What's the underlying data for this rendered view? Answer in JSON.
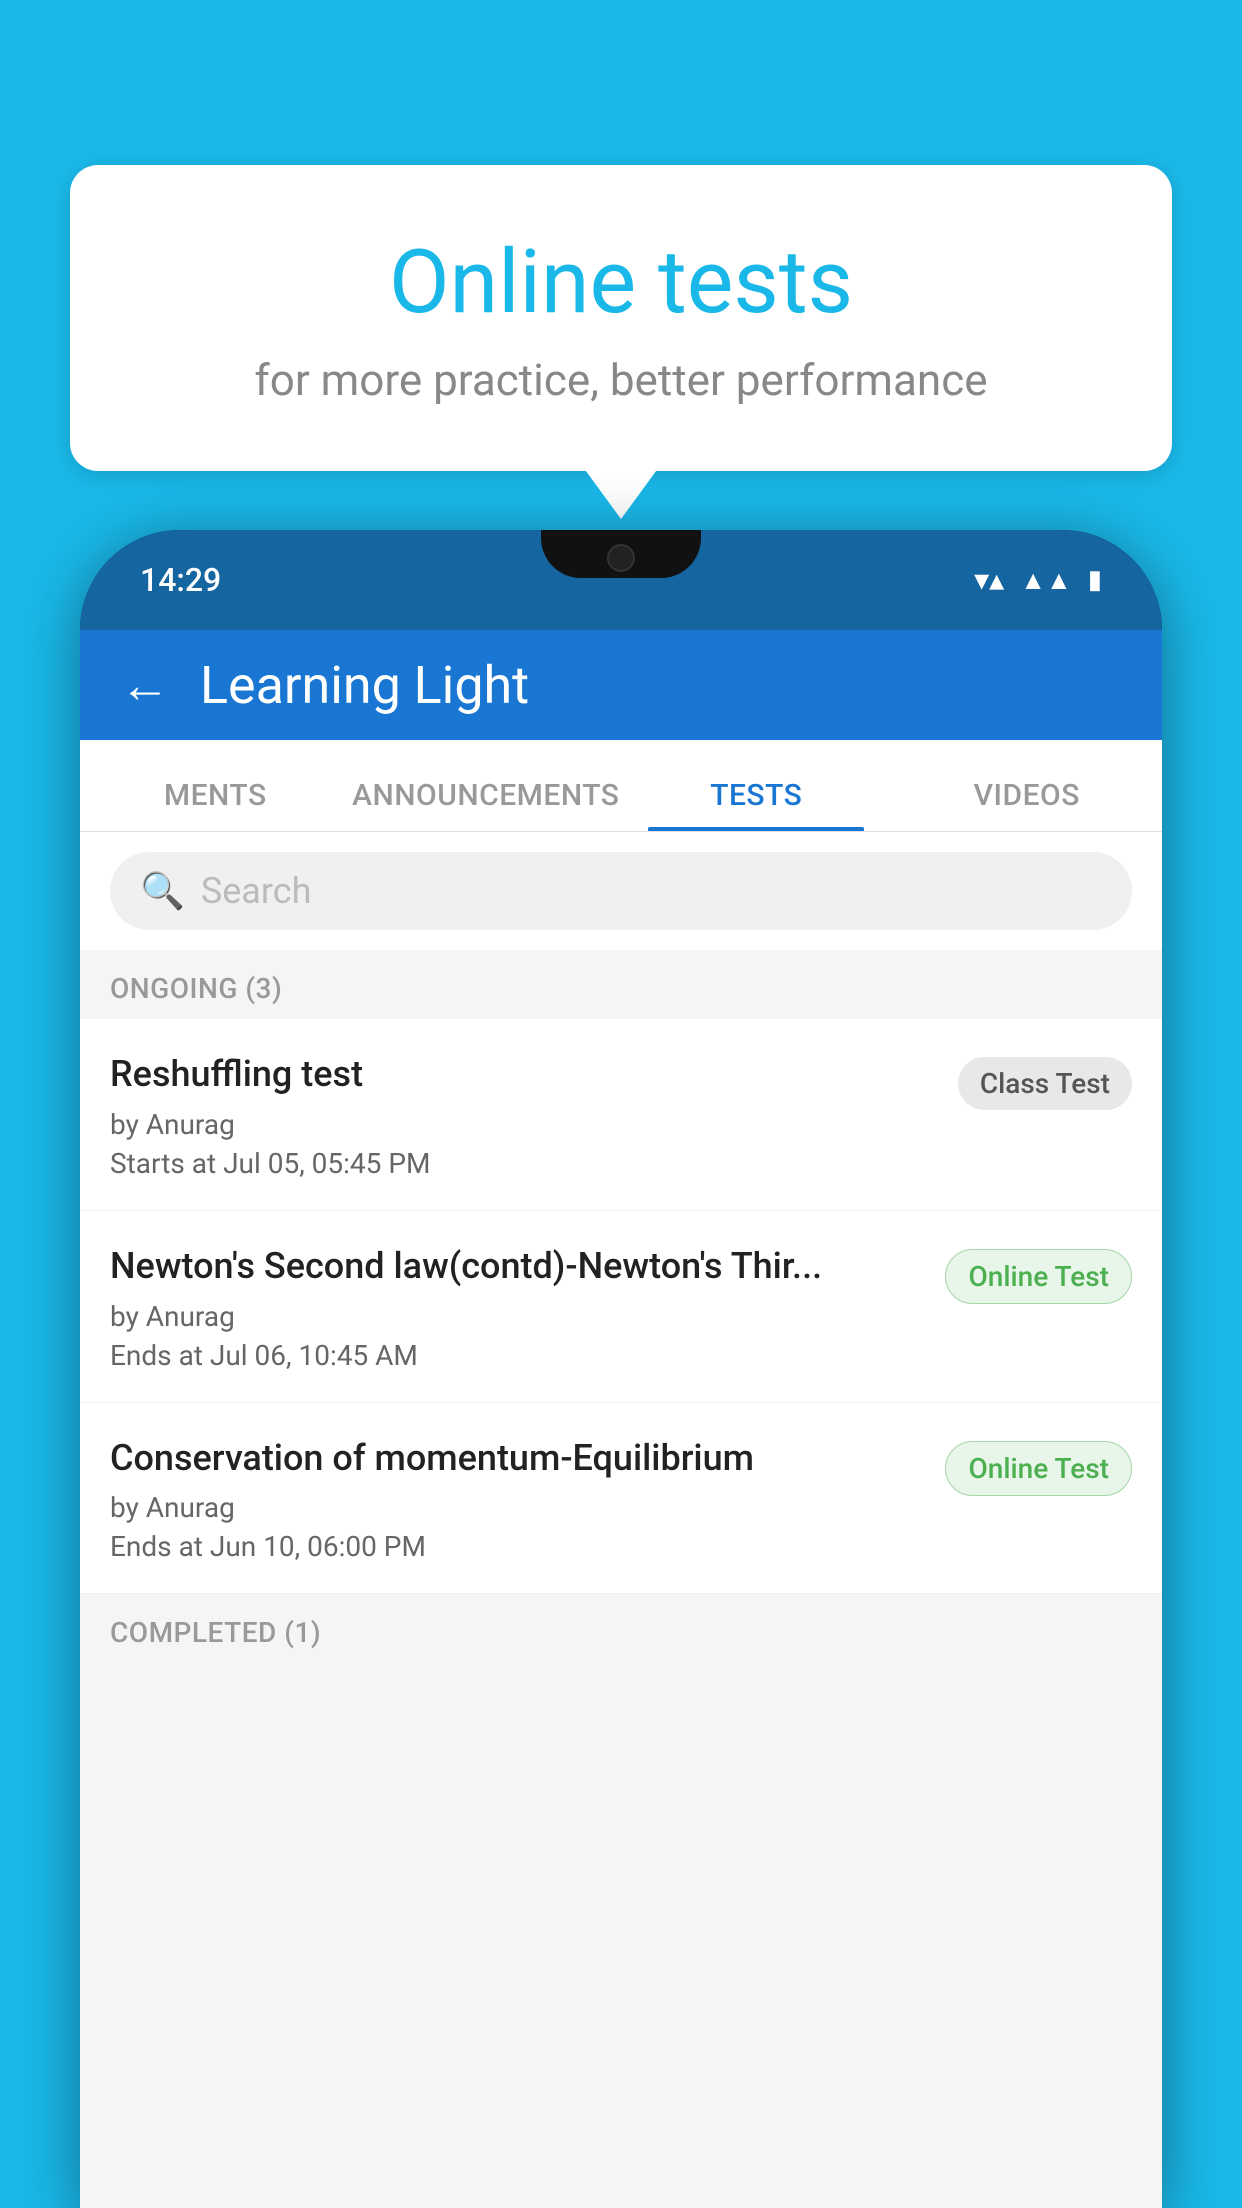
{
  "background_color": "#1ab8e8",
  "speech_bubble": {
    "title": "Online tests",
    "subtitle": "for more practice, better performance"
  },
  "phone": {
    "status_bar": {
      "time": "14:29"
    },
    "header": {
      "title": "Learning Light",
      "back_label": "←"
    },
    "tabs": [
      {
        "label": "MENTS",
        "active": false
      },
      {
        "label": "ANNOUNCEMENTS",
        "active": false
      },
      {
        "label": "TESTS",
        "active": true
      },
      {
        "label": "VIDEOS",
        "active": false
      }
    ],
    "search": {
      "placeholder": "Search"
    },
    "ongoing_section": {
      "title": "ONGOING (3)"
    },
    "tests": [
      {
        "name": "Reshuffling test",
        "author": "by Anurag",
        "time_label": "Starts at  Jul 05, 05:45 PM",
        "badge": "Class Test",
        "badge_type": "class"
      },
      {
        "name": "Newton's Second law(contd)-Newton's Thir...",
        "author": "by Anurag",
        "time_label": "Ends at  Jul 06, 10:45 AM",
        "badge": "Online Test",
        "badge_type": "online"
      },
      {
        "name": "Conservation of momentum-Equilibrium",
        "author": "by Anurag",
        "time_label": "Ends at  Jun 10, 06:00 PM",
        "badge": "Online Test",
        "badge_type": "online"
      }
    ],
    "completed_section": {
      "title": "COMPLETED (1)"
    }
  }
}
